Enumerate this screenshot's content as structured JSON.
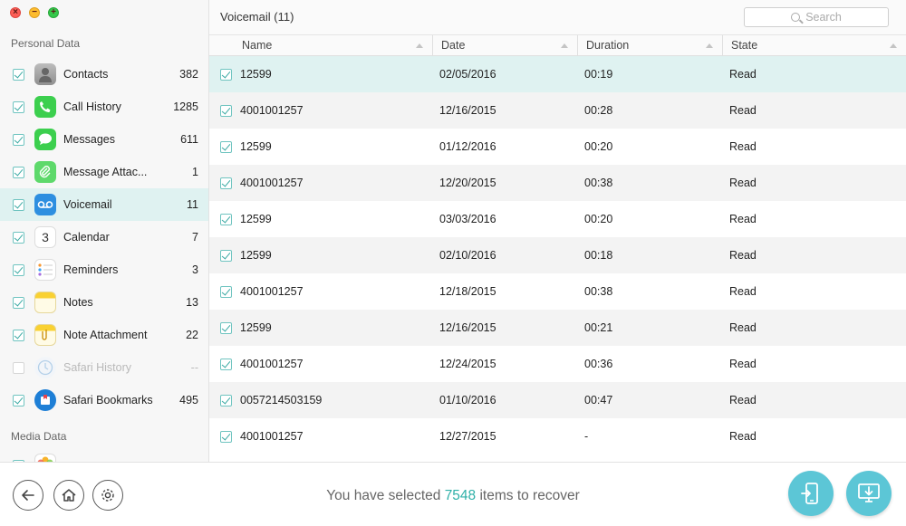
{
  "window": {
    "traffic_lights": {
      "close_glyph": "×",
      "minimize_glyph": "−",
      "maximize_glyph": "+"
    }
  },
  "sidebar": {
    "personal_section_title": "Personal Data",
    "media_section_title": "Media Data",
    "items": [
      {
        "label": "Contacts",
        "count": "382",
        "icon": "contacts-icon",
        "checked": true,
        "active": false
      },
      {
        "label": "Call History",
        "count": "1285",
        "icon": "phone-icon",
        "checked": true,
        "active": false
      },
      {
        "label": "Messages",
        "count": "611",
        "icon": "messages-icon",
        "checked": true,
        "active": false
      },
      {
        "label": "Message Attac...",
        "count": "1",
        "icon": "paperclip-icon",
        "checked": true,
        "active": false
      },
      {
        "label": "Voicemail",
        "count": "11",
        "icon": "voicemail-icon",
        "checked": true,
        "active": true
      },
      {
        "label": "Calendar",
        "count": "7",
        "icon": "calendar-icon",
        "checked": true,
        "active": false,
        "icon_text": "3"
      },
      {
        "label": "Reminders",
        "count": "3",
        "icon": "reminders-icon",
        "checked": true,
        "active": false
      },
      {
        "label": "Notes",
        "count": "13",
        "icon": "notes-icon",
        "checked": true,
        "active": false
      },
      {
        "label": "Note Attachment",
        "count": "22",
        "icon": "note-attachment-icon",
        "checked": true,
        "active": false
      },
      {
        "label": "Safari History",
        "count": "--",
        "icon": "safari-history-icon",
        "checked": false,
        "active": false,
        "disabled": true
      },
      {
        "label": "Safari Bookmarks",
        "count": "495",
        "icon": "safari-bookmarks-icon",
        "checked": true,
        "active": false
      }
    ]
  },
  "header": {
    "title": "Voicemail (11)",
    "search_placeholder": "Search"
  },
  "table": {
    "columns": [
      "Name",
      "Date",
      "Duration",
      "State"
    ],
    "rows": [
      {
        "name": "12599",
        "date": "02/05/2016",
        "duration": "00:19",
        "state": "Read",
        "selected": true
      },
      {
        "name": "4001001257",
        "date": "12/16/2015",
        "duration": "00:28",
        "state": "Read"
      },
      {
        "name": "12599",
        "date": "01/12/2016",
        "duration": "00:20",
        "state": "Read"
      },
      {
        "name": "4001001257",
        "date": "12/20/2015",
        "duration": "00:38",
        "state": "Read"
      },
      {
        "name": "12599",
        "date": "03/03/2016",
        "duration": "00:20",
        "state": "Read"
      },
      {
        "name": "12599",
        "date": "02/10/2016",
        "duration": "00:18",
        "state": "Read"
      },
      {
        "name": "4001001257",
        "date": "12/18/2015",
        "duration": "00:38",
        "state": "Read"
      },
      {
        "name": "12599",
        "date": "12/16/2015",
        "duration": "00:21",
        "state": "Read"
      },
      {
        "name": "4001001257",
        "date": "12/24/2015",
        "duration": "00:36",
        "state": "Read"
      },
      {
        "name": "0057214503159",
        "date": "01/10/2016",
        "duration": "00:47",
        "state": "Read"
      },
      {
        "name": "4001001257",
        "date": "12/27/2015",
        "duration": "-",
        "state": "Read"
      }
    ]
  },
  "footer": {
    "message_prefix": "You have selected ",
    "selected_count": "7548",
    "message_suffix": " items to recover",
    "buttons": [
      "back-button",
      "home-button",
      "settings-button",
      "recover-to-device-button",
      "recover-to-computer-button"
    ]
  },
  "colors": {
    "accent": "#2fb0a8",
    "active_row": "#dff2f1",
    "action_button": "#5cc6d6"
  }
}
